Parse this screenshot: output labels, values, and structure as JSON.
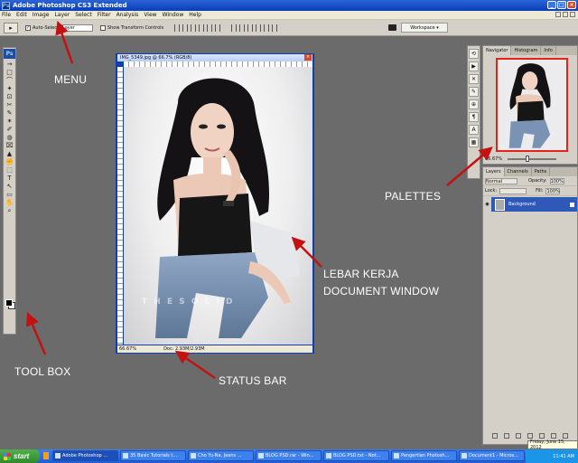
{
  "app": {
    "title": "Adobe Photoshop CS3 Extended",
    "logo": "Ps"
  },
  "menu": [
    "File",
    "Edit",
    "Image",
    "Layer",
    "Select",
    "Filter",
    "Analysis",
    "View",
    "Window",
    "Help"
  ],
  "options": {
    "auto_select_label": "Auto-Select",
    "auto_select_value": "Layer",
    "show_transform_label": "Show Transform Controls",
    "workspace_label": "Workspace ▾"
  },
  "tools": [
    "→",
    "□",
    "⌒",
    "✦",
    "⊡",
    "✂",
    "✎",
    "✶",
    "✐",
    "◍",
    "⌧",
    "▲",
    "✊",
    "⬚",
    "T",
    "↖",
    "▭",
    "✋",
    "⌕"
  ],
  "document": {
    "title": "IMG_5349.jpg @ 66.7% (RGB/8)",
    "zoom": "66.67%",
    "doc_size": "Doc: 2.93M/2.93M",
    "watermark": "T H E  S O L I D"
  },
  "panels": {
    "navigator_tabs": [
      "Navigator",
      "Histogram",
      "Info"
    ],
    "navigator_zoom": "66.67%",
    "layers_tabs": [
      "Layers",
      "Channels",
      "Paths"
    ],
    "blend_mode": "Normal",
    "opacity_label": "Opacity:",
    "opacity_value": "100%",
    "lock_label": "Lock:",
    "fill_label": "Fill:",
    "fill_value": "100%",
    "layer_name": "Background"
  },
  "annotations": {
    "menu": "MENU",
    "palettes": "PALETTES",
    "document_line1": "LEBAR KERJA",
    "document_line2": "DOCUMENT WINDOW",
    "toolbox": "TOOL BOX",
    "status_bar": "STATUS BAR"
  },
  "tooltip": "Friday, June 15, 2012",
  "taskbar": {
    "start": "start",
    "tasks": [
      "Adobe Photoshop ...",
      "35 Basic Tutorials t...",
      "Cho Yu-Na, Jeans ...",
      "BLOG PSD.rar - Win...",
      "BLOG PSD.txt - Not...",
      "Pengertian Photosh...",
      "Document1 - Micros..."
    ],
    "clock": "11:41 AM"
  },
  "colors": {
    "annotation_arrow": "#c41111",
    "xp_taskbar": "#215dd6",
    "doc_border": "#0f3fae",
    "nav_view_box": "#e2231a"
  }
}
